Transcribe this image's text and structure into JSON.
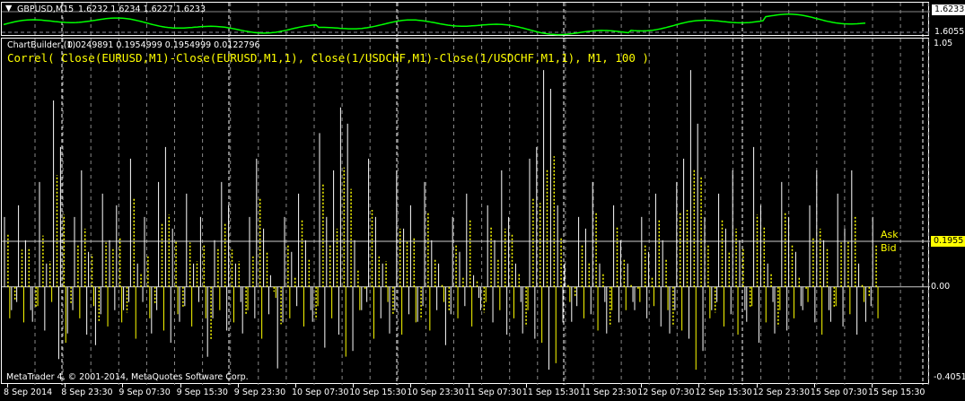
{
  "price_pane": {
    "symbol": "GBPUSD,M15",
    "ohlc": "1.6232 1.6234 1.6227 1.6233",
    "current_price": "1.6233",
    "scale_low": "1.6055",
    "line_color": "#00ff00"
  },
  "indicator_pane": {
    "name": "ChartBuilder (1)",
    "values": "0.0249891 0.1954999 0.1954999 0.0122796",
    "formula": "Correl( Close(EURUSD,M1)-Close(EURUSD,M1,1), Close(1/USDCHF,M1)-Close(1/USDCHF,M1,1), M1, 100 )",
    "scale_max": "1.05",
    "scale_min": "-0.4051",
    "zero_label": "0.00",
    "current_value": "0.1955",
    "ask_label": "Ask",
    "bid_label": "Bid",
    "colors": {
      "main": "#ffffff",
      "secondary": "#ffff00",
      "tag_bg": "#ffff00"
    }
  },
  "copyright": "MetaTrader 4, © 2001-2014, MetaQuotes Software Corp.",
  "time_axis": [
    "8 Sep 2014",
    "8 Sep 23:30",
    "9 Sep 07:30",
    "9 Sep 15:30",
    "9 Sep 23:30",
    "10 Sep 07:30",
    "10 Sep 15:30",
    "10 Sep 23:30",
    "11 Sep 07:30",
    "11 Sep 15:30",
    "11 Sep 23:30",
    "12 Sep 07:30",
    "12 Sep 15:30",
    "12 Sep 23:30",
    "15 Sep 07:30",
    "15 Sep 15:30"
  ],
  "chart_data": {
    "type": "bar",
    "ylim": [
      -0.4051,
      1.05
    ],
    "reference_lines": [
      0,
      0.1955
    ],
    "values": [
      0.3,
      -0.1,
      0.35,
      0.2,
      -0.15,
      0.45,
      0.1,
      0.8,
      0.6,
      -0.2,
      0.3,
      0.5,
      0.15,
      -0.25,
      0.4,
      0.2,
      0.35,
      -0.1,
      0.55,
      0.1,
      0.3,
      -0.2,
      0.45,
      0.6,
      0.25,
      -0.15,
      0.4,
      0.1,
      0.3,
      -0.3,
      0.2,
      0.45,
      0.35,
      0.1,
      -0.2,
      0.3,
      0.55,
      0.25,
      0.05,
      -0.35,
      0.3,
      0.15,
      0.4,
      0.2,
      -0.15,
      0.66,
      0.3,
      0.5,
      0.77,
      0.7,
      0.2,
      -0.1,
      0.55,
      0.3,
      0.1,
      -0.2,
      0.5,
      0.25,
      0.35,
      -0.15,
      0.45,
      0.2,
      0.1,
      -0.25,
      0.3,
      0.15,
      0.4,
      0.05,
      -0.1,
      0.35,
      0.2,
      0.5,
      0.3,
      0.1,
      -0.2,
      0.55,
      0.6,
      0.93,
      0.85,
      0.35,
      0.1,
      -0.15,
      0.3,
      0.25,
      0.45,
      0.1,
      -0.2,
      0.35,
      0.2,
      0.1,
      -0.1,
      0.3,
      0.15,
      0.4,
      0.2,
      -0.2,
      0.45,
      0.55,
      0.93,
      0.7,
      0.3,
      -0.1,
      0.4,
      0.25,
      0.5,
      0.2,
      -0.15,
      0.6,
      0.35,
      0.1,
      -0.2,
      0.45,
      0.3,
      0.15,
      -0.1,
      0.35,
      0.5,
      0.2,
      -0.15,
      0.4,
      0.25,
      0.5,
      0.1,
      -0.15,
      0.3
    ]
  }
}
